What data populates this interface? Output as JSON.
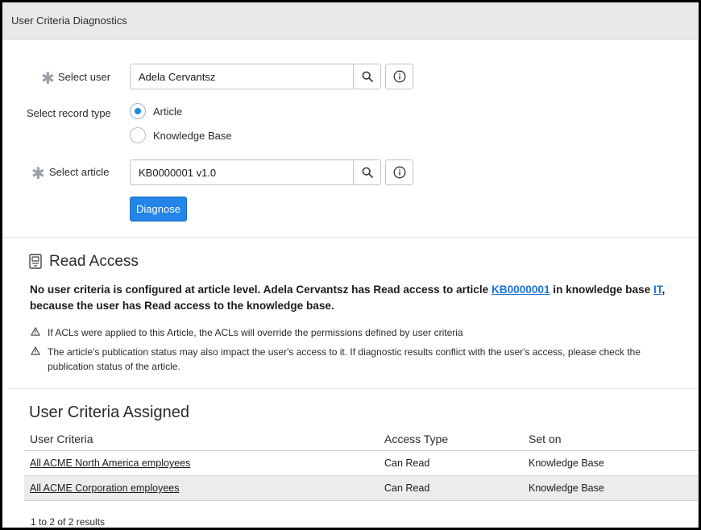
{
  "header": {
    "title": "User Criteria Diagnostics"
  },
  "form": {
    "user": {
      "label": "Select user",
      "value": "Adela Cervantsz"
    },
    "record_type": {
      "label": "Select record type",
      "options": [
        {
          "label": "Article",
          "checked": true
        },
        {
          "label": "Knowledge Base",
          "checked": false
        }
      ]
    },
    "article": {
      "label": "Select article",
      "value": "KB0000001 v1.0"
    },
    "diagnose_label": "Diagnose"
  },
  "read_access": {
    "title": "Read Access",
    "message_part1": "No user criteria is configured at article level. Adela Cervantsz has Read access to article ",
    "article_link": "KB0000001",
    "message_part2": " in knowledge base ",
    "kb_link": "IT",
    "message_part3": ", because the user has Read access to the knowledge base.",
    "warnings": [
      "If ACLs were applied to this Article, the ACLs will override the permissions defined by user criteria",
      "The article's publication status may also impact the user's access to it. If diagnostic results conflict with the user's access, please check the publication status of the article."
    ]
  },
  "criteria": {
    "title": "User Criteria Assigned",
    "columns": [
      "User Criteria",
      "Access Type",
      "Set on"
    ],
    "rows": [
      [
        "All ACME North America employees",
        "Can Read",
        "Knowledge Base"
      ],
      [
        "All ACME Corporation employees",
        "Can Read",
        "Knowledge Base"
      ]
    ],
    "results": "1 to 2 of 2 results"
  },
  "colors": {
    "accent": "#2485e8",
    "link": "#1a73d9",
    "header_bg": "#e7e9eb"
  },
  "icons": [
    "asterisk-icon",
    "search-icon",
    "info-icon",
    "read-access-icon",
    "warning-icon"
  ]
}
